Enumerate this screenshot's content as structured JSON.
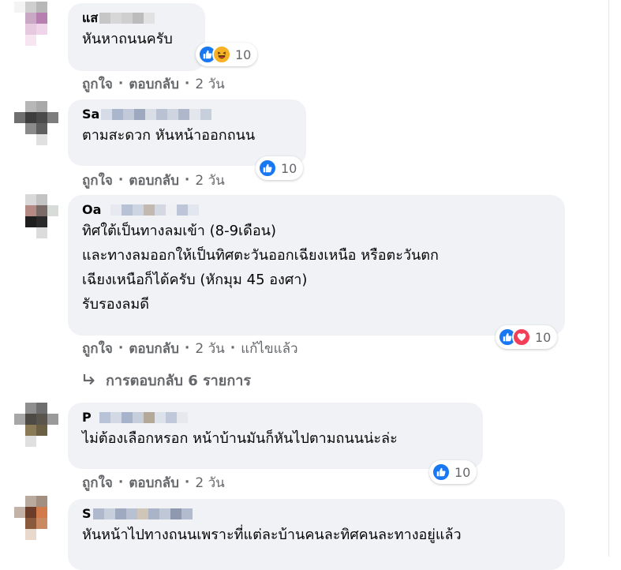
{
  "comments": [
    {
      "name": "แส",
      "lines": [
        "หันหาถนนครับ"
      ],
      "reactions": {
        "icons": [
          "like-icon",
          "haha-icon"
        ],
        "count": "10"
      },
      "actions": {
        "like": "ถูกใจ",
        "reply": "ตอบกลับ",
        "time": "2 วัน"
      }
    },
    {
      "name": "Sa",
      "lines": [
        "ตามสะดวก หันหน้าออกถนน"
      ],
      "reactions": {
        "icons": [
          "like-icon"
        ],
        "count": "10"
      },
      "actions": {
        "like": "ถูกใจ",
        "reply": "ตอบกลับ",
        "time": "2 วัน"
      }
    },
    {
      "name": "Oa",
      "lines": [
        "ทิศใต้เป็นทางลมเข้า (8-9เดือน)",
        "และทางลมออกให้เป็นทิศตะวันออกเฉียงเหนือ หรือตะวันตก",
        "เฉียงเหนือก็ได้ครับ (หักมุม 45 องศา)",
        "รับรองลมดี"
      ],
      "reactions": {
        "icons": [
          "like-icon",
          "love-icon"
        ],
        "count": "10"
      },
      "actions": {
        "like": "ถูกใจ",
        "reply": "ตอบกลับ",
        "time": "2 วัน",
        "edited": "แก้ไขแล้ว"
      }
    },
    {
      "name": "P",
      "lines": [
        "ไม่ต้องเลือกหรอก หน้าบ้านมันก็หันไปตามถนนน่ะล่ะ"
      ],
      "reactions": {
        "icons": [
          "like-icon"
        ],
        "count": "10"
      },
      "actions": {
        "like": "ถูกใจ",
        "reply": "ตอบกลับ",
        "time": "2 วัน"
      }
    },
    {
      "name": "S",
      "lines": [
        "หันหน้าไปทางถนนเพราะที่แต่ละบ้านคนละทิศคนละทางอยู่แล้ว"
      ]
    }
  ],
  "view_replies": "การตอบกลับ 6 รายการ",
  "colors": {
    "bubble": "#f0f2f5",
    "secondary_text": "#65676b",
    "like": "#1877f2",
    "love": "#f33e58",
    "haha": "#f7b125"
  }
}
